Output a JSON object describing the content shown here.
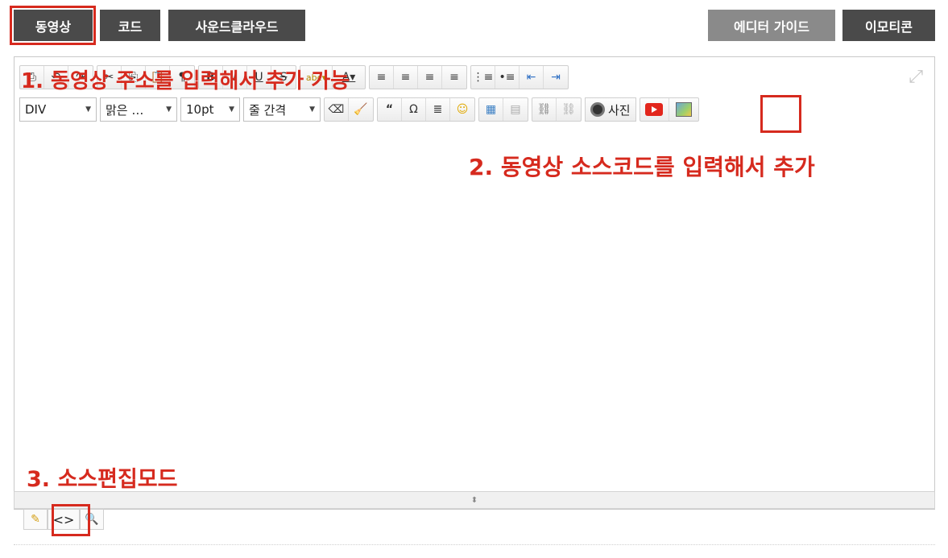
{
  "tabs_left": [
    {
      "label": "동영상"
    },
    {
      "label": "코드"
    },
    {
      "label": "사운드클라우드"
    }
  ],
  "tabs_right": [
    {
      "label": "에디터 가이드"
    },
    {
      "label": "이모티콘"
    }
  ],
  "toolbar_row2": {
    "block_format": "DIV",
    "font_family": "맑은 …",
    "font_size": "10pt",
    "line_height": "줄 간격",
    "photo_label": "사진"
  },
  "annotations": {
    "a1": "1. 동영상 주소를 입력해서 추가 가능",
    "a2": "2. 동영상 소스코드를 입력해서 추가",
    "a3": "3. 소스편집모드"
  },
  "colors": {
    "annotation": "#d62a1e",
    "tab_dark": "#4a4a4a",
    "tab_light": "#8a8a8a"
  }
}
